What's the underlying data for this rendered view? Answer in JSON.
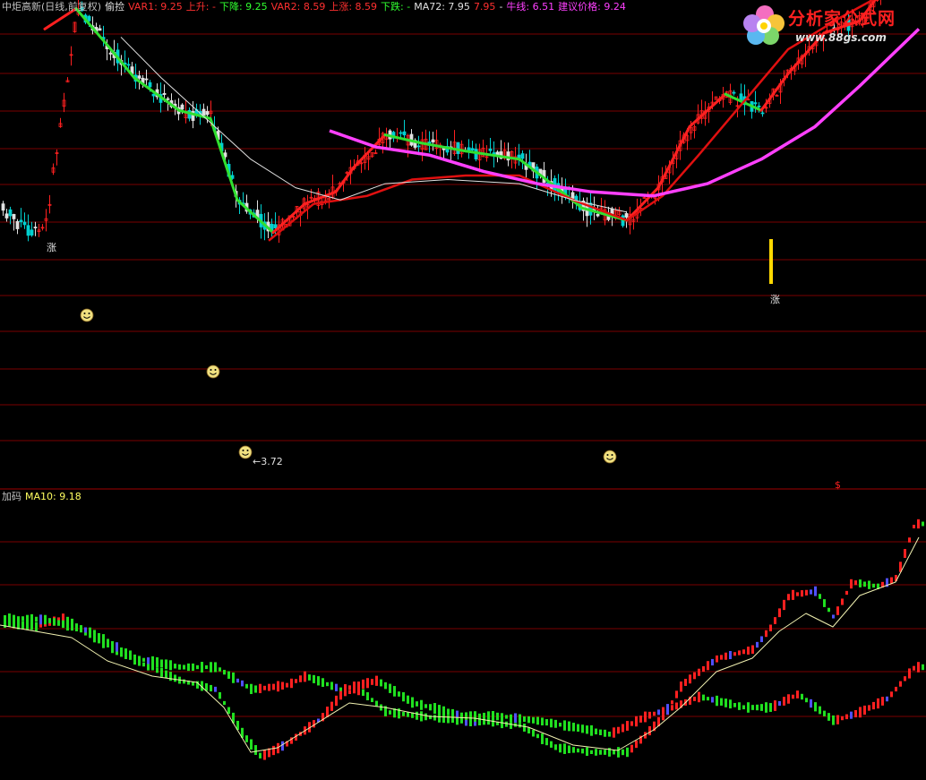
{
  "header": {
    "items": [
      {
        "text": "中炬高新(日线,前复权)",
        "color": "#c0c0c0"
      },
      {
        "text": "偷捡",
        "color": "#e0e0e0"
      },
      {
        "text": "VAR1: 9.25",
        "color": "#ff3030"
      },
      {
        "text": "上升: -",
        "color": "#ff3030"
      },
      {
        "text": "下降: 9.25",
        "color": "#30ff30"
      },
      {
        "text": "VAR2: 8.59",
        "color": "#ff3030"
      },
      {
        "text": "上涨: 8.59",
        "color": "#ff3030"
      },
      {
        "text": "下跌: -",
        "color": "#30ff30"
      },
      {
        "text": "MA72: 7.95",
        "color": "#e0e0e0"
      },
      {
        "text": "7.95",
        "color": "#ff3030"
      },
      {
        "text": "-",
        "color": "#e0e0e0"
      },
      {
        "text": "牛线: 6.51",
        "color": "#ff40ff"
      },
      {
        "text": "建议价格: 9.24",
        "color": "#ff40ff"
      }
    ]
  },
  "sub_header": {
    "items": [
      {
        "text": "加码",
        "color": "#c0c0c0"
      },
      {
        "text": "MA10: 9.18",
        "color": "#ffff60"
      }
    ]
  },
  "watermark": {
    "title": "分析家公式网",
    "url": "www.88gs.com"
  },
  "markers": {
    "rise_label": "涨",
    "low_label": "←3.72",
    "dollar_label": "$"
  },
  "colors": {
    "up": "#ff2020",
    "down": "#20ff20",
    "magenta": "#ff40ff",
    "white": "#e0e0e0",
    "smile": "#f0e080",
    "yellow": "#ffd800",
    "grid": "#7a0000"
  },
  "chart_data": [
    {
      "type": "line",
      "title": "中炬高新(日线,前复权)",
      "series_approx": {
        "fast_line_green_down_red_up": [
          [
            0,
            "none"
          ],
          [
            50,
            8.15
          ],
          [
            85,
            8.4
          ],
          [
            120,
            7.95
          ],
          [
            150,
            7.55
          ],
          [
            200,
            7.15
          ],
          [
            235,
            7.05
          ],
          [
            265,
            6.05
          ],
          [
            305,
            5.65
          ],
          [
            340,
            6.0
          ],
          [
            375,
            6.15
          ],
          [
            395,
            6.45
          ],
          [
            430,
            6.85
          ],
          [
            470,
            6.75
          ],
          [
            520,
            6.65
          ],
          [
            580,
            6.55
          ],
          [
            610,
            6.3
          ],
          [
            650,
            5.95
          ],
          [
            700,
            5.8
          ],
          [
            735,
            6.2
          ],
          [
            770,
            6.95
          ],
          [
            810,
            7.35
          ],
          [
            850,
            7.15
          ],
          [
            880,
            7.6
          ],
          [
            920,
            8.1
          ],
          [
            960,
            8.25
          ],
          [
            1000,
            8.85
          ],
          [
            1026,
            9.25
          ]
        ],
        "slow_red_line": [
          [
            300,
            5.55
          ],
          [
            350,
            6.0
          ],
          [
            410,
            6.1
          ],
          [
            460,
            6.3
          ],
          [
            520,
            6.35
          ],
          [
            580,
            6.35
          ],
          [
            640,
            6.05
          ],
          [
            700,
            5.8
          ],
          [
            740,
            6.1
          ],
          [
            780,
            6.6
          ],
          [
            830,
            7.25
          ],
          [
            880,
            7.9
          ],
          [
            940,
            8.3
          ],
          [
            990,
            8.6
          ],
          [
            1026,
            8.8
          ]
        ],
        "MA72_white": [
          [
            135,
            8.05
          ],
          [
            180,
            7.55
          ],
          [
            230,
            7.05
          ],
          [
            280,
            6.55
          ],
          [
            330,
            6.2
          ],
          [
            380,
            6.05
          ],
          [
            430,
            6.25
          ],
          [
            500,
            6.3
          ],
          [
            580,
            6.25
          ],
          [
            640,
            6.05
          ],
          [
            700,
            5.9
          ]
        ],
        "bull_line_magenta": [
          [
            368,
            6.9
          ],
          [
            420,
            6.7
          ],
          [
            480,
            6.6
          ],
          [
            540,
            6.4
          ],
          [
            600,
            6.25
          ],
          [
            660,
            6.15
          ],
          [
            730,
            6.1
          ],
          [
            790,
            6.25
          ],
          [
            850,
            6.55
          ],
          [
            910,
            6.95
          ],
          [
            960,
            7.45
          ],
          [
            1026,
            8.15
          ]
        ],
        "low_annotation": 3.72
      }
    },
    {
      "type": "line",
      "title": "加码",
      "series": [
        {
          "name": "MA10",
          "last_value": 9.18
        }
      ]
    }
  ]
}
